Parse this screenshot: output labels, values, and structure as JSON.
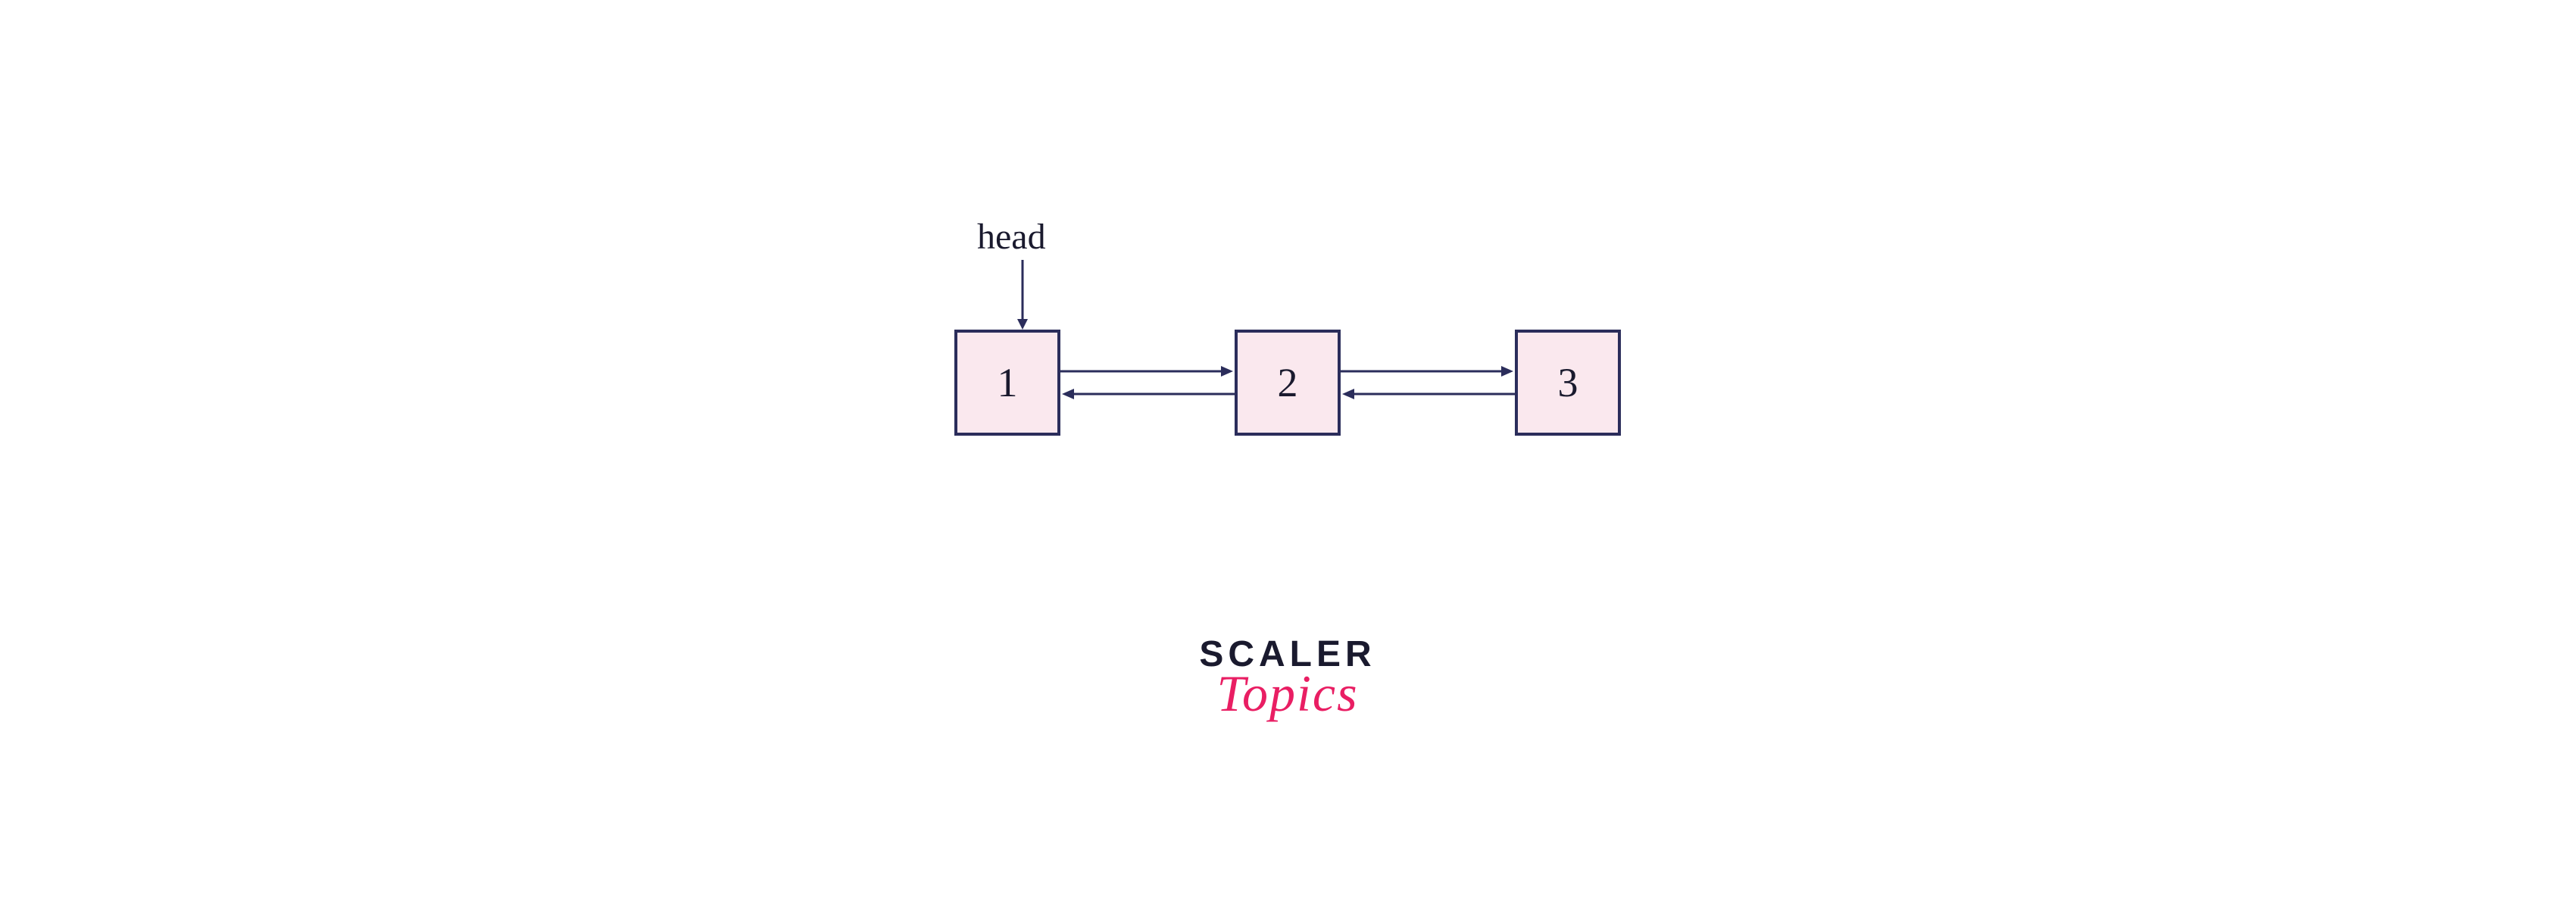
{
  "diagram": {
    "head_label": "head",
    "nodes": [
      "1",
      "2",
      "3"
    ],
    "colors": {
      "node_fill": "#fae8ee",
      "node_border": "#2b2d5b",
      "arrow": "#2b2d5b",
      "text": "#1a1a2e"
    }
  },
  "logo": {
    "line1": "SCALER",
    "line2": "Topics"
  }
}
